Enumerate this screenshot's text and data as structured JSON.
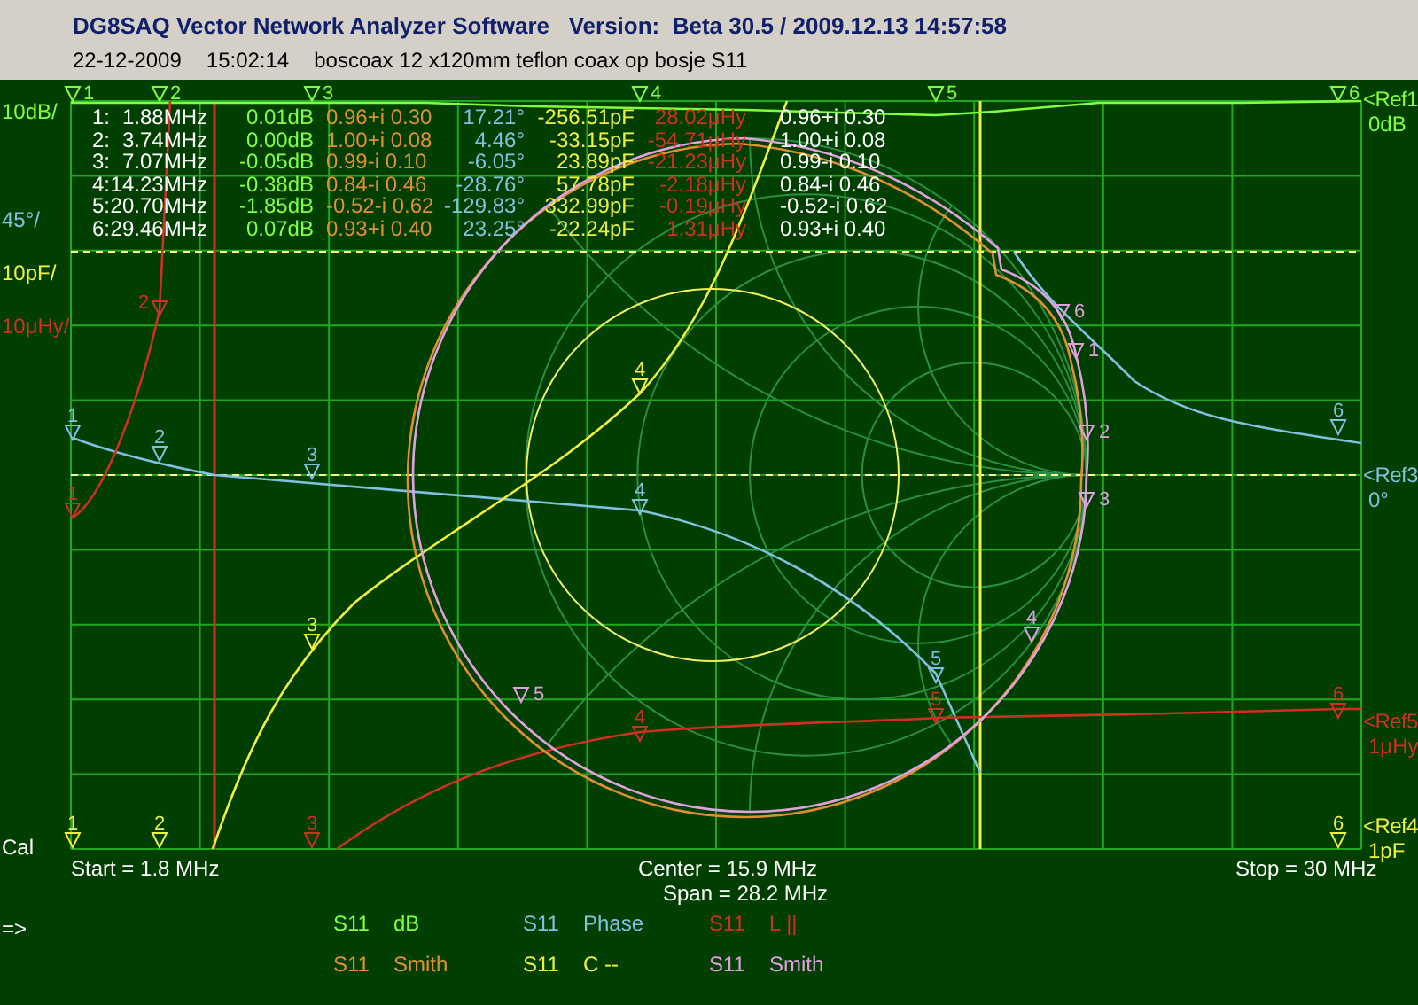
{
  "window": {
    "title": "DG8SAQ Vector Network Analyzer Software   Version:  Beta 30.5 / 2009.12.13 14:57:58",
    "date": "22-12-2009",
    "time": "15:02:14",
    "note": "boscoax 12 x120mm teflon coax op bosje S11"
  },
  "scale_labels": [
    {
      "text": "10dB/",
      "color": "#80ff40"
    },
    {
      "text": "45°/",
      "color": "#80c0e0"
    },
    {
      "text": "10pF/",
      "color": "#f0f040"
    },
    {
      "text": "10μHy/",
      "color": "#d03020"
    }
  ],
  "marker_table": [
    {
      "index": "1:",
      "frequency": "1.88MHz",
      "db": "0.01dB",
      "smith": "0.96+i 0.30",
      "phase": "17.21°",
      "capacitance": "-256.51pF",
      "inductance": "28.02μHy",
      "smith_2": "0.96+i 0.30"
    },
    {
      "index": "2:",
      "frequency": "3.74MHz",
      "db": "0.00dB",
      "smith": "1.00+i 0.08",
      "phase": "4.46°",
      "capacitance": "-33.15pF",
      "inductance": "-54.71μHy",
      "smith_2": "1.00+i 0.08"
    },
    {
      "index": "3:",
      "frequency": "7.07MHz",
      "db": "-0.05dB",
      "smith": "0.99-i 0.10",
      "phase": "-6.05°",
      "capacitance": "23.89pF",
      "inductance": "-21.23μHy",
      "smith_2": "0.99-i 0.10"
    },
    {
      "index": "4:",
      "frequency": "14.23MHz",
      "db": "-0.38dB",
      "smith": "0.84-i 0.46",
      "phase": "-28.76°",
      "capacitance": "57.78pF",
      "inductance": "-2.18μHy",
      "smith_2": "0.84-i 0.46"
    },
    {
      "index": "5:",
      "frequency": "20.70MHz",
      "db": "-1.85dB",
      "smith": "-0.52-i 0.62",
      "phase": "-129.83°",
      "capacitance": "332.99pF",
      "inductance": "-0.19μHy",
      "smith_2": "-0.52-i 0.62"
    },
    {
      "index": "6:",
      "frequency": "29.46MHz",
      "db": "0.07dB",
      "smith": "0.93+i 0.40",
      "phase": "23.25°",
      "capacitance": "-22.24pF",
      "inductance": "1.31μHy",
      "smith_2": "0.93+i 0.40"
    }
  ],
  "traces": [
    {
      "parameter": "S11",
      "format": "dB",
      "kind": "db",
      "color": "#80ff40",
      "markers": [
        "1",
        "2",
        "3",
        "4",
        "5",
        "6"
      ]
    },
    {
      "parameter": "S11",
      "format": "Phase",
      "kind": "phase",
      "color": "#80c0e0",
      "markers": [
        "1",
        "2",
        "3",
        "4",
        "5",
        "6"
      ]
    },
    {
      "parameter": "S11",
      "format": "L ||",
      "kind": "inductance",
      "color": "#d03020",
      "markers": [
        "1",
        "2",
        "3",
        "4",
        "5",
        "6"
      ]
    },
    {
      "parameter": "S11",
      "format": "Smith",
      "kind": "smith",
      "color": "#e09030"
    },
    {
      "parameter": "S11",
      "format": "C --",
      "kind": "capacitance",
      "color": "#f0f040",
      "markers": [
        "1",
        "2",
        "3",
        "4",
        "6"
      ]
    },
    {
      "parameter": "S11",
      "format": "Smith",
      "kind": "smith_pink",
      "color": "#e0a0e0",
      "markers": [
        "1",
        "2",
        "3",
        "4",
        "5",
        "6"
      ]
    }
  ],
  "ref_labels": [
    {
      "ref": "<Ref1",
      "value": "0dB",
      "color": "#80ff40"
    },
    {
      "ref": "<Ref3",
      "value": "0°",
      "color": "#80c0e0"
    },
    {
      "ref": "<Ref5",
      "value": "1μHy",
      "color": "#d03020"
    },
    {
      "ref": "<Ref4",
      "value": "1pF",
      "color": "#f0f040"
    }
  ],
  "cal_label": "Cal",
  "prompt": "=>",
  "sweep": {
    "start": "Start = 1.8 MHz",
    "center": "Center = 15.9 MHz",
    "span": "Span = 28.2 MHz",
    "stop": "Stop = 30 MHz"
  }
}
